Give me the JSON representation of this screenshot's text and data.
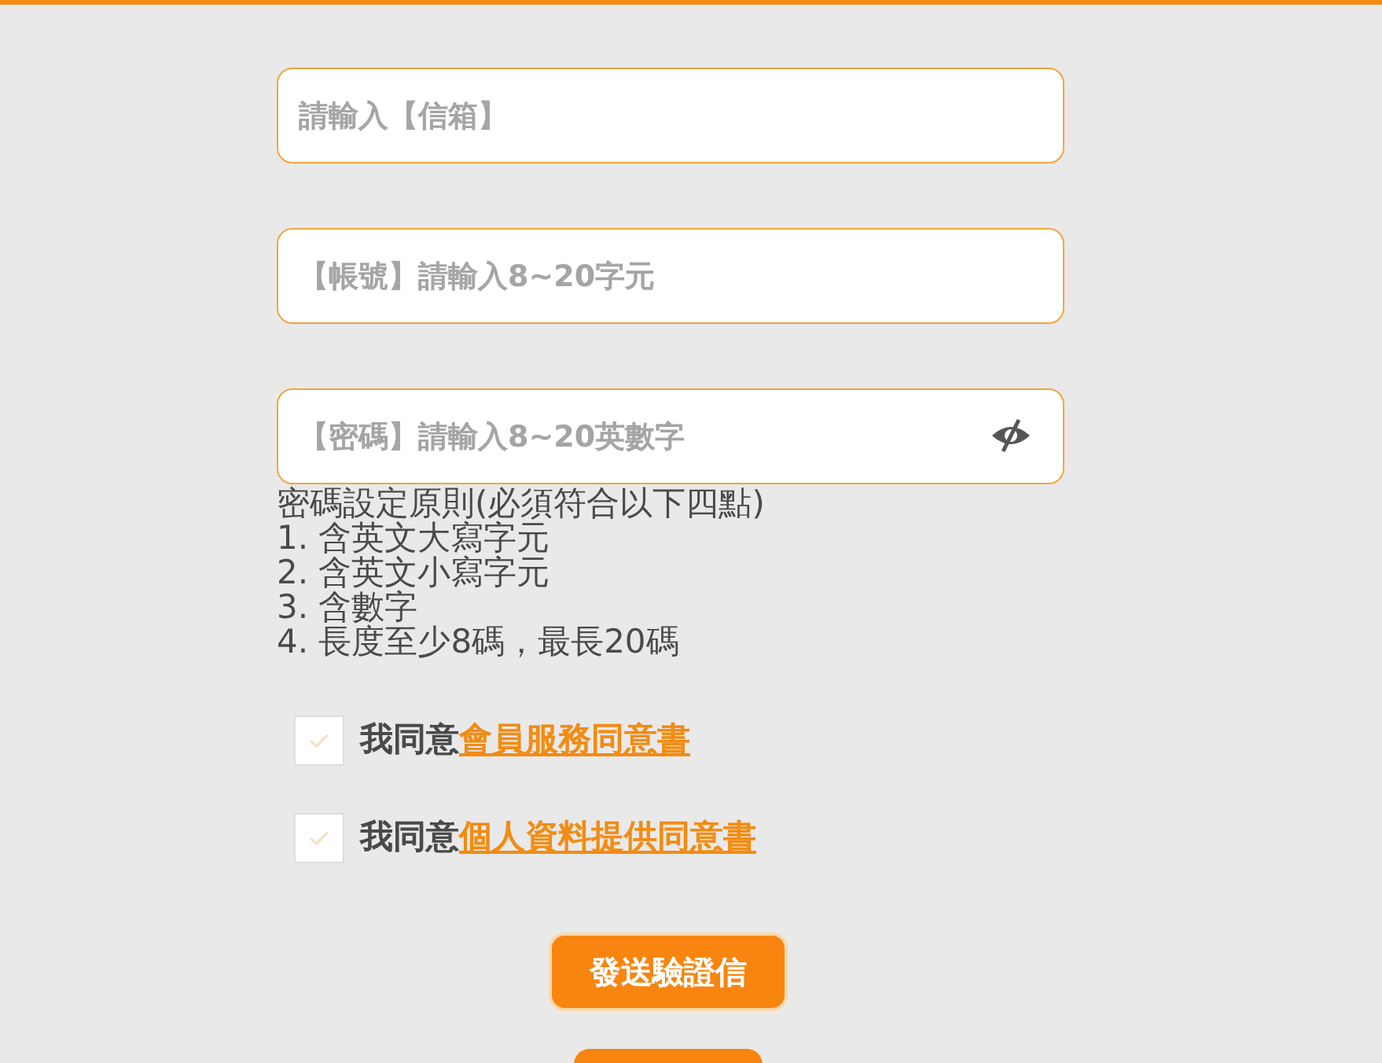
{
  "fields": [
    {
      "placeholder": "請輸入【信箱】",
      "kind": "text"
    },
    {
      "placeholder": "【帳號】請輸入8~20字元",
      "kind": "text"
    },
    {
      "placeholder": "【密碼】請輸入8~20英數字",
      "kind": "password"
    }
  ],
  "password_rules": [
    "密碼設定原則(必須符合以下四點)",
    "1. 含英文大寫字元",
    "2. 含英文小寫字元",
    "3. 含數字",
    "4. 長度至少8碼，最長20碼"
  ],
  "agreements": [
    {
      "text": "我同意",
      "link": "會員服務同意書",
      "checked": false
    },
    {
      "text": "我同意",
      "link": "個人資料提供同意書",
      "checked": false
    }
  ],
  "send_button": {
    "label": "發送驗證信"
  }
}
